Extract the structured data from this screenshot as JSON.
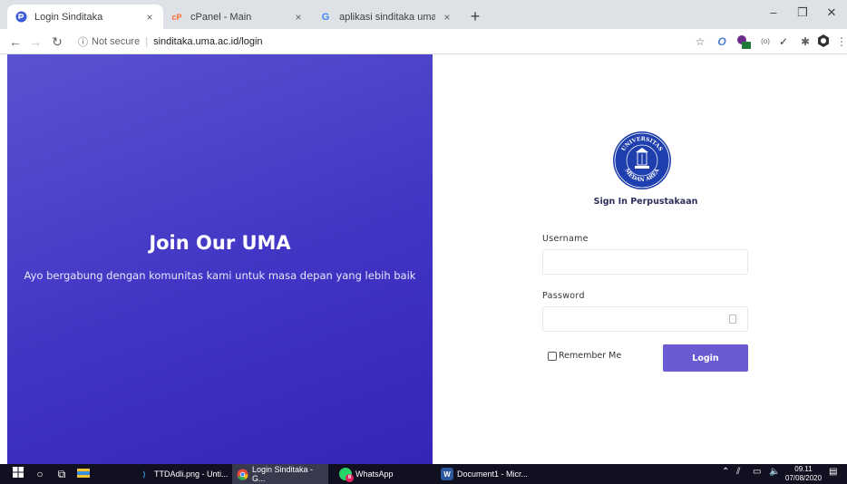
{
  "browser": {
    "tabs": [
      {
        "title": "Login Sinditaka",
        "close": "×"
      },
      {
        "title": "cPanel - Main",
        "close": "×"
      },
      {
        "title": "aplikasi sinditaka uma - Penelusu",
        "close": "×"
      }
    ],
    "new_tab": "+",
    "security": "Not secure",
    "url": "sinditaka.uma.ac.id/login",
    "window": {
      "minimize": "–",
      "maximize": "❐",
      "close": "✕"
    },
    "extension_badge": "24"
  },
  "hero": {
    "title": "Join Our UMA",
    "subtitle": "Ayo bergabung dengan komunitas kami untuk masa depan yang lebih baik",
    "gradient": [
      "#5a53d0",
      "#3524b8"
    ]
  },
  "login": {
    "logo_text_top": "UNIVERSITAS",
    "logo_text_bottom": "MEDAN AREA",
    "heading": "Sign In Perpustakaan",
    "username_label": "Username",
    "username_value": "",
    "password_label": "Password",
    "password_value": "",
    "remember_label": "Remember Me",
    "remember_checked": false,
    "button_label": "Login",
    "accent": "#6b5bd3"
  },
  "taskbar": {
    "apps": [
      {
        "label": "TTDAdli.png - Unti..."
      },
      {
        "label": "Login Sinditaka - G..."
      },
      {
        "label": "WhatsApp"
      },
      {
        "label": "Document1 - Micr..."
      }
    ],
    "whatsapp_badge": "6",
    "time": "09.11",
    "date": "07/08/2020"
  }
}
